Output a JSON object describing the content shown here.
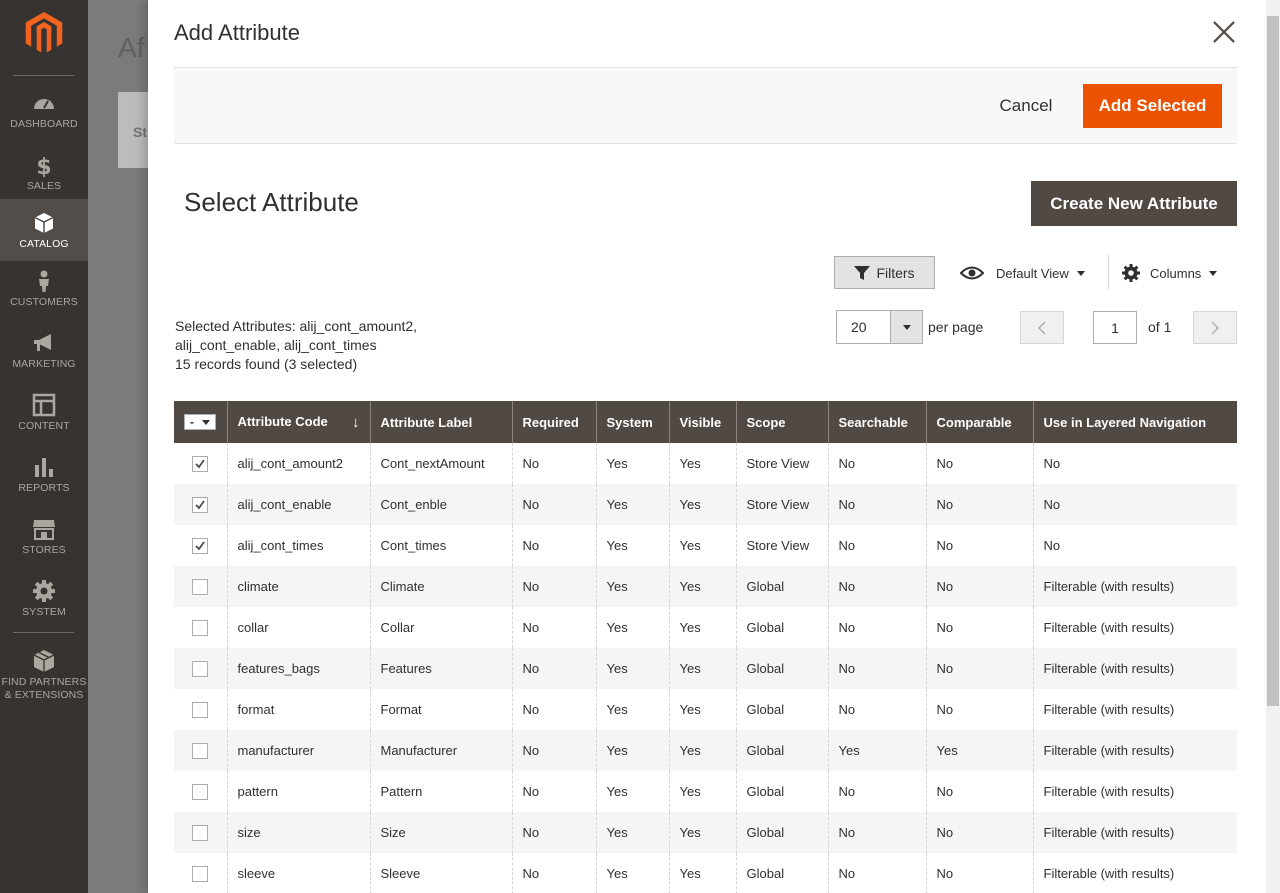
{
  "sidebar": {
    "items": [
      {
        "label": "DASHBOARD",
        "icon": "dashboard-icon",
        "active": false
      },
      {
        "label": "SALES",
        "icon": "dollar-icon",
        "active": false
      },
      {
        "label": "CATALOG",
        "icon": "box-icon",
        "active": true
      },
      {
        "label": "CUSTOMERS",
        "icon": "person-icon",
        "active": false
      },
      {
        "label": "MARKETING",
        "icon": "megaphone-icon",
        "active": false
      },
      {
        "label": "CONTENT",
        "icon": "layout-icon",
        "active": false
      },
      {
        "label": "REPORTS",
        "icon": "bar-chart-icon",
        "active": false
      },
      {
        "label": "STORES",
        "icon": "store-icon",
        "active": false
      },
      {
        "label": "SYSTEM",
        "icon": "gear-icon",
        "active": false
      },
      {
        "label": "FIND PARTNERS & EXTENSIONS",
        "icon": "cubes-icon",
        "active": false
      }
    ]
  },
  "background": {
    "title": "Af",
    "panel_text": "St"
  },
  "modal": {
    "title": "Add Attribute",
    "cancel_label": "Cancel",
    "add_selected_label": "Add Selected",
    "section_title": "Select Attribute",
    "create_label": "Create New Attribute"
  },
  "toolbar": {
    "filters_label": "Filters",
    "view_label": "Default View",
    "columns_label": "Columns",
    "selected_line1": "Selected Attributes: alij_cont_amount2,",
    "selected_line2": "alij_cont_enable, alij_cont_times",
    "records_found": "15 records found (3 selected)",
    "per_page_value": "20",
    "per_page_label": "per page",
    "page_current": "1",
    "page_total": "of 1"
  },
  "colors": {
    "accent": "#eb5202",
    "header_bg": "#514943",
    "sidebar_bg": "#373330"
  },
  "grid": {
    "columns": [
      "Attribute Code",
      "Attribute Label",
      "Required",
      "System",
      "Visible",
      "Scope",
      "Searchable",
      "Comparable",
      "Use in Layered Navigation"
    ],
    "sort_indicator": "↓",
    "mass_select_symbol": "-",
    "rows": [
      {
        "checked": true,
        "cells": [
          "alij_cont_amount2",
          "Cont_nextAmount",
          "No",
          "Yes",
          "Yes",
          "Store View",
          "No",
          "No",
          "No"
        ]
      },
      {
        "checked": true,
        "cells": [
          "alij_cont_enable",
          "Cont_enble",
          "No",
          "Yes",
          "Yes",
          "Store View",
          "No",
          "No",
          "No"
        ]
      },
      {
        "checked": true,
        "cells": [
          "alij_cont_times",
          "Cont_times",
          "No",
          "Yes",
          "Yes",
          "Store View",
          "No",
          "No",
          "No"
        ]
      },
      {
        "checked": false,
        "cells": [
          "climate",
          "Climate",
          "No",
          "Yes",
          "Yes",
          "Global",
          "No",
          "No",
          "Filterable (with results)"
        ]
      },
      {
        "checked": false,
        "cells": [
          "collar",
          "Collar",
          "No",
          "Yes",
          "Yes",
          "Global",
          "No",
          "No",
          "Filterable (with results)"
        ]
      },
      {
        "checked": false,
        "cells": [
          "features_bags",
          "Features",
          "No",
          "Yes",
          "Yes",
          "Global",
          "No",
          "No",
          "Filterable (with results)"
        ]
      },
      {
        "checked": false,
        "cells": [
          "format",
          "Format",
          "No",
          "Yes",
          "Yes",
          "Global",
          "No",
          "No",
          "Filterable (with results)"
        ]
      },
      {
        "checked": false,
        "cells": [
          "manufacturer",
          "Manufacturer",
          "No",
          "Yes",
          "Yes",
          "Global",
          "Yes",
          "Yes",
          "Filterable (with results)"
        ]
      },
      {
        "checked": false,
        "cells": [
          "pattern",
          "Pattern",
          "No",
          "Yes",
          "Yes",
          "Global",
          "No",
          "No",
          "Filterable (with results)"
        ]
      },
      {
        "checked": false,
        "cells": [
          "size",
          "Size",
          "No",
          "Yes",
          "Yes",
          "Global",
          "No",
          "No",
          "Filterable (with results)"
        ]
      },
      {
        "checked": false,
        "cells": [
          "sleeve",
          "Sleeve",
          "No",
          "Yes",
          "Yes",
          "Global",
          "No",
          "No",
          "Filterable (with results)"
        ]
      }
    ]
  }
}
